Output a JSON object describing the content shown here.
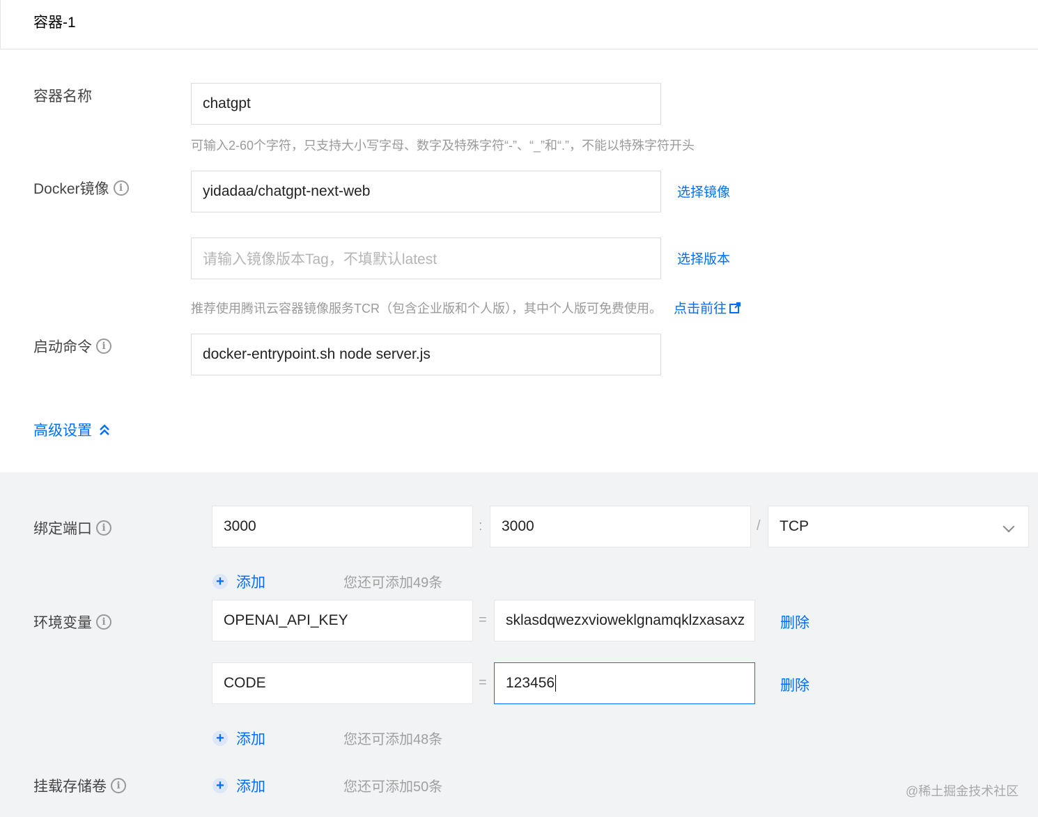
{
  "header": {
    "title": "容器-1"
  },
  "form": {
    "container_name": {
      "label": "容器名称",
      "value": "chatgpt",
      "hint": "可输入2-60个字符，只支持大小写字母、数字及特殊字符“-”、“_”和“.”，不能以特殊字符开头"
    },
    "docker_image": {
      "label": "Docker镜像",
      "value": "yidadaa/chatgpt-next-web",
      "select_image_link": "选择镜像",
      "tag_placeholder": "请输入镜像版本Tag，不填默认latest",
      "select_version_link": "选择版本",
      "recommend_hint": "推荐使用腾讯云容器镜像服务TCR（包含企业版和个人版），其中个人版可免费使用。",
      "goto_link": "点击前往"
    },
    "start_command": {
      "label": "启动命令",
      "value": "docker-entrypoint.sh node server.js"
    },
    "advanced_toggle": "高级设置"
  },
  "advanced": {
    "port_binding": {
      "label": "绑定端口",
      "host_port": "3000",
      "colon": ":",
      "container_port": "3000",
      "slash": "/",
      "protocol": "TCP",
      "add_label": "添加",
      "remaining": "您还可添加49条"
    },
    "env_vars": {
      "label": "环境变量",
      "equals": "=",
      "rows": [
        {
          "key": "OPENAI_API_KEY",
          "value": "sklasdqwezxvioweklgnamqklzxasaxz",
          "delete": "删除"
        },
        {
          "key": "CODE",
          "value": "123456",
          "delete": "删除"
        }
      ],
      "add_label": "添加",
      "remaining": "您还可添加48条"
    },
    "volumes": {
      "label": "挂载存储卷",
      "add_label": "添加",
      "remaining": "您还可添加50条"
    }
  },
  "watermark": "@稀土掘金技术社区",
  "colors": {
    "accent": "#006eff",
    "gray_bg": "#f2f3f5"
  }
}
